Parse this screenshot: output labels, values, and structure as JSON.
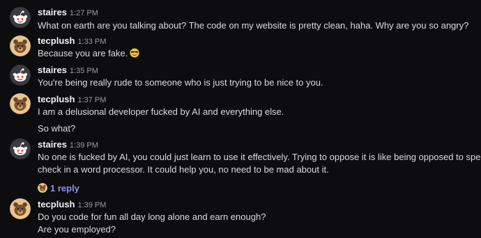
{
  "colors": {
    "background": "#0d0d0f",
    "reply_link": "#8a93f5",
    "timestamp": "#9b9ba3"
  },
  "messages": [
    {
      "author": "staires",
      "avatar": "reddit-snoo-avatar",
      "time": "1:27 PM",
      "lines": [
        "What on earth are you talking about? The code on my website is pretty clean, haha. Why are you so angry?"
      ]
    },
    {
      "author": "tecplush",
      "avatar": "bear-avatar",
      "time": "1:33 PM",
      "lines": [
        "Because you are fake."
      ],
      "emoji": "sunglasses-smile-emoji"
    },
    {
      "author": "staires",
      "avatar": "reddit-snoo-avatar",
      "time": "1:35 PM",
      "lines": [
        "You're being really rude to someone who is just trying to be nice to you."
      ]
    },
    {
      "author": "tecplush",
      "avatar": "bear-avatar",
      "time": "1:37 PM",
      "lines": [
        "I am a delusional developer fucked by AI and everything else.",
        "So what?"
      ]
    },
    {
      "author": "staires",
      "avatar": "reddit-snoo-avatar",
      "time": "1:39 PM",
      "lines": [
        "No one is fucked by AI, you could just learn to use it effectively. Trying to oppose it is like being opposed to spell",
        "check in a word processor. It could help you, no need to be mad about it."
      ],
      "reply_label": "1 reply"
    },
    {
      "author": "tecplush",
      "avatar": "bear-avatar",
      "time": "1:39 PM",
      "lines": [
        "Do you code for fun all day long alone and earn enough?",
        "Are you employed?"
      ]
    }
  ]
}
